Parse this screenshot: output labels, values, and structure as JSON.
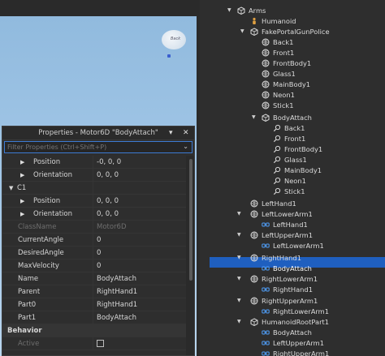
{
  "properties": {
    "title": "Properties - Motor6D \"BodyAttach\"",
    "filter_placeholder": "Filter Properties (Ctrl+Shift+P)",
    "rows": [
      {
        "key": "Position",
        "value": "-0, 0, 0"
      },
      {
        "key": "Orientation",
        "value": "0, 0, 0"
      },
      {
        "key": "C1",
        "value": ""
      },
      {
        "key": "Position",
        "value": "0, 0, 0"
      },
      {
        "key": "Orientation",
        "value": "0, 0, 0"
      },
      {
        "key": "ClassName",
        "value": "Motor6D"
      },
      {
        "key": "CurrentAngle",
        "value": "0"
      },
      {
        "key": "DesiredAngle",
        "value": "0"
      },
      {
        "key": "MaxVelocity",
        "value": "0"
      },
      {
        "key": "Name",
        "value": "BodyAttach"
      },
      {
        "key": "Parent",
        "value": "RightHand1"
      },
      {
        "key": "Part0",
        "value": "RightHand1"
      },
      {
        "key": "Part1",
        "value": "BodyAttach"
      },
      {
        "key": "Behavior",
        "value": ""
      },
      {
        "key": "Active",
        "value": ""
      }
    ],
    "active_checked": false
  },
  "viewport": {
    "balloon_text": "Back"
  },
  "explorer": {
    "items": [
      {
        "label": "Arms",
        "icon": "model-icon"
      },
      {
        "label": "Humanoid",
        "icon": "humanoid-icon"
      },
      {
        "label": "FakePortalGunPolice",
        "icon": "model-icon"
      },
      {
        "label": "Back1",
        "icon": "part-icon"
      },
      {
        "label": "Front1",
        "icon": "part-icon"
      },
      {
        "label": "FrontBody1",
        "icon": "part-icon"
      },
      {
        "label": "Glass1",
        "icon": "part-icon"
      },
      {
        "label": "MainBody1",
        "icon": "part-icon"
      },
      {
        "label": "Neon1",
        "icon": "part-icon"
      },
      {
        "label": "Stick1",
        "icon": "part-icon"
      },
      {
        "label": "BodyAttach",
        "icon": "model-icon"
      },
      {
        "label": "Back1",
        "icon": "weld-icon"
      },
      {
        "label": "Front1",
        "icon": "weld-icon"
      },
      {
        "label": "FrontBody1",
        "icon": "weld-icon"
      },
      {
        "label": "Glass1",
        "icon": "weld-icon"
      },
      {
        "label": "MainBody1",
        "icon": "weld-icon"
      },
      {
        "label": "Neon1",
        "icon": "weld-icon"
      },
      {
        "label": "Stick1",
        "icon": "weld-icon"
      },
      {
        "label": "LeftHand1",
        "icon": "part-icon"
      },
      {
        "label": "LeftLowerArm1",
        "icon": "part-icon"
      },
      {
        "label": "LeftHand1",
        "icon": "motor-icon"
      },
      {
        "label": "LeftUpperArm1",
        "icon": "part-icon"
      },
      {
        "label": "LeftLowerArm1",
        "icon": "motor-icon"
      },
      {
        "label": "RightHand1",
        "icon": "part-icon"
      },
      {
        "label": "BodyAttach",
        "icon": "motor-icon"
      },
      {
        "label": "RightLowerArm1",
        "icon": "part-icon"
      },
      {
        "label": "RightHand1",
        "icon": "motor-icon"
      },
      {
        "label": "RightUpperArm1",
        "icon": "part-icon"
      },
      {
        "label": "RightLowerArm1",
        "icon": "motor-icon"
      },
      {
        "label": "HumanoidRootPart1",
        "icon": "model-icon"
      },
      {
        "label": "BodyAttach",
        "icon": "motor-icon"
      },
      {
        "label": "LeftUpperArm1",
        "icon": "motor-icon"
      },
      {
        "label": "RightUpperArm1",
        "icon": "motor-icon"
      }
    ],
    "selected_label": "BodyAttach",
    "colors": {
      "selection": "#1f5fbf",
      "motor_icon": "#4f9ef8"
    }
  }
}
